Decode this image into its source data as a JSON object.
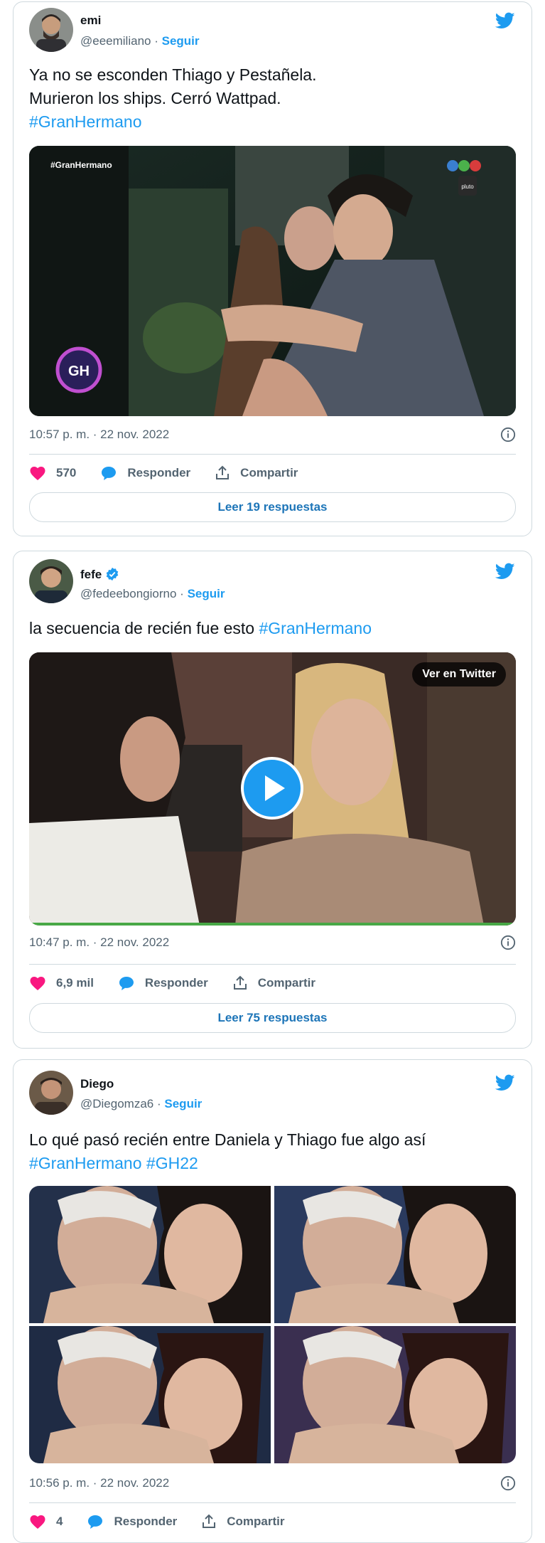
{
  "tweets": [
    {
      "name": "emi",
      "handle": "@eeemiliano",
      "dot": "·",
      "follow": "Seguir",
      "text_lines": [
        "Ya no se esconden Thiago y Pestañela.",
        "Murieron los ships. Cerró Wattpad."
      ],
      "hashtags": "#GranHermano",
      "media_overlay": "#GranHermano",
      "timestamp": "10:57 p. m. · 22 nov. 2022",
      "likes": "570",
      "reply": "Responder",
      "share": "Compartir",
      "read_more": "Leer 19 respuestas"
    },
    {
      "name": "fefe",
      "handle": "@fedeebongiorno",
      "dot": "·",
      "follow": "Seguir",
      "text_plain": "la secuencia de recién fue esto ",
      "hashtags": "#GranHermano",
      "media_button": "Ver en Twitter",
      "timestamp": "10:47 p. m. · 22 nov. 2022",
      "likes": "6,9 mil",
      "reply": "Responder",
      "share": "Compartir",
      "read_more": "Leer 75 respuestas"
    },
    {
      "name": "Diego",
      "handle": "@Diegomza6",
      "dot": "·",
      "follow": "Seguir",
      "text_plain": "Lo qué pasó recién entre Daniela y Thiago fue algo así",
      "hashtags": "#GranHermano #GH22",
      "timestamp": "10:56 p. m. · 22 nov. 2022",
      "likes": "4",
      "reply": "Responder",
      "share": "Compartir"
    }
  ],
  "colors": {
    "accent": "#1d9bf0",
    "like": "#f91880",
    "muted": "#536471",
    "border": "#cfd9de"
  }
}
